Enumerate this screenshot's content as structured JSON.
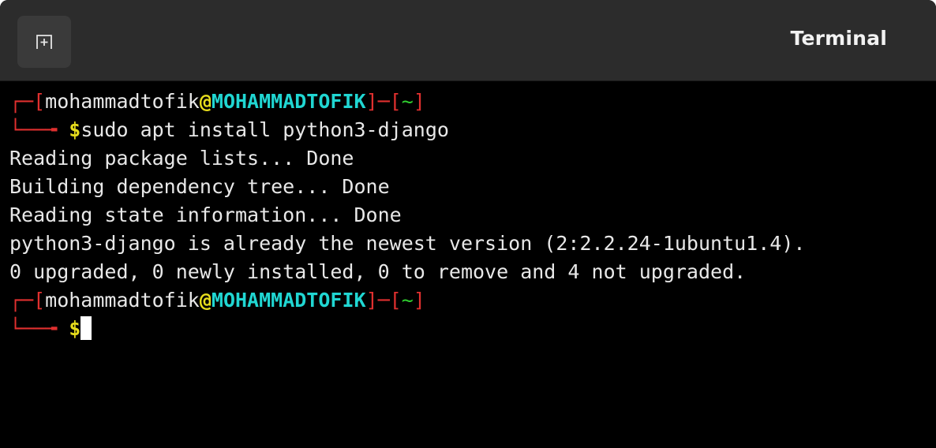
{
  "window": {
    "title": "Terminal",
    "new_tab_icon": "new-tab-icon"
  },
  "colors": {
    "bracket": "#e0302f",
    "host": "#20d6d2",
    "dir": "#2fcf2f",
    "dollar": "#e6dc1c"
  },
  "terminal": {
    "prompt1": {
      "open_bracket": "┌─[",
      "user": "mohammadtofik",
      "at": "@",
      "host": "MOHAMMADTOFIK",
      "sep": "]─[",
      "dir": "~",
      "close": "]",
      "arrow": "└──╼ ",
      "dollar": "$",
      "command": "sudo apt install python3-django"
    },
    "output": [
      "Reading package lists... Done",
      "Building dependency tree... Done",
      "Reading state information... Done",
      "python3-django is already the newest version (2:2.2.24-1ubuntu1.4).",
      "0 upgraded, 0 newly installed, 0 to remove and 4 not upgraded."
    ],
    "prompt2": {
      "open_bracket": "┌─[",
      "user": "mohammadtofik",
      "at": "@",
      "host": "MOHAMMADTOFIK",
      "sep": "]─[",
      "dir": "~",
      "close": "]",
      "arrow": "└──╼ ",
      "dollar": "$"
    }
  }
}
